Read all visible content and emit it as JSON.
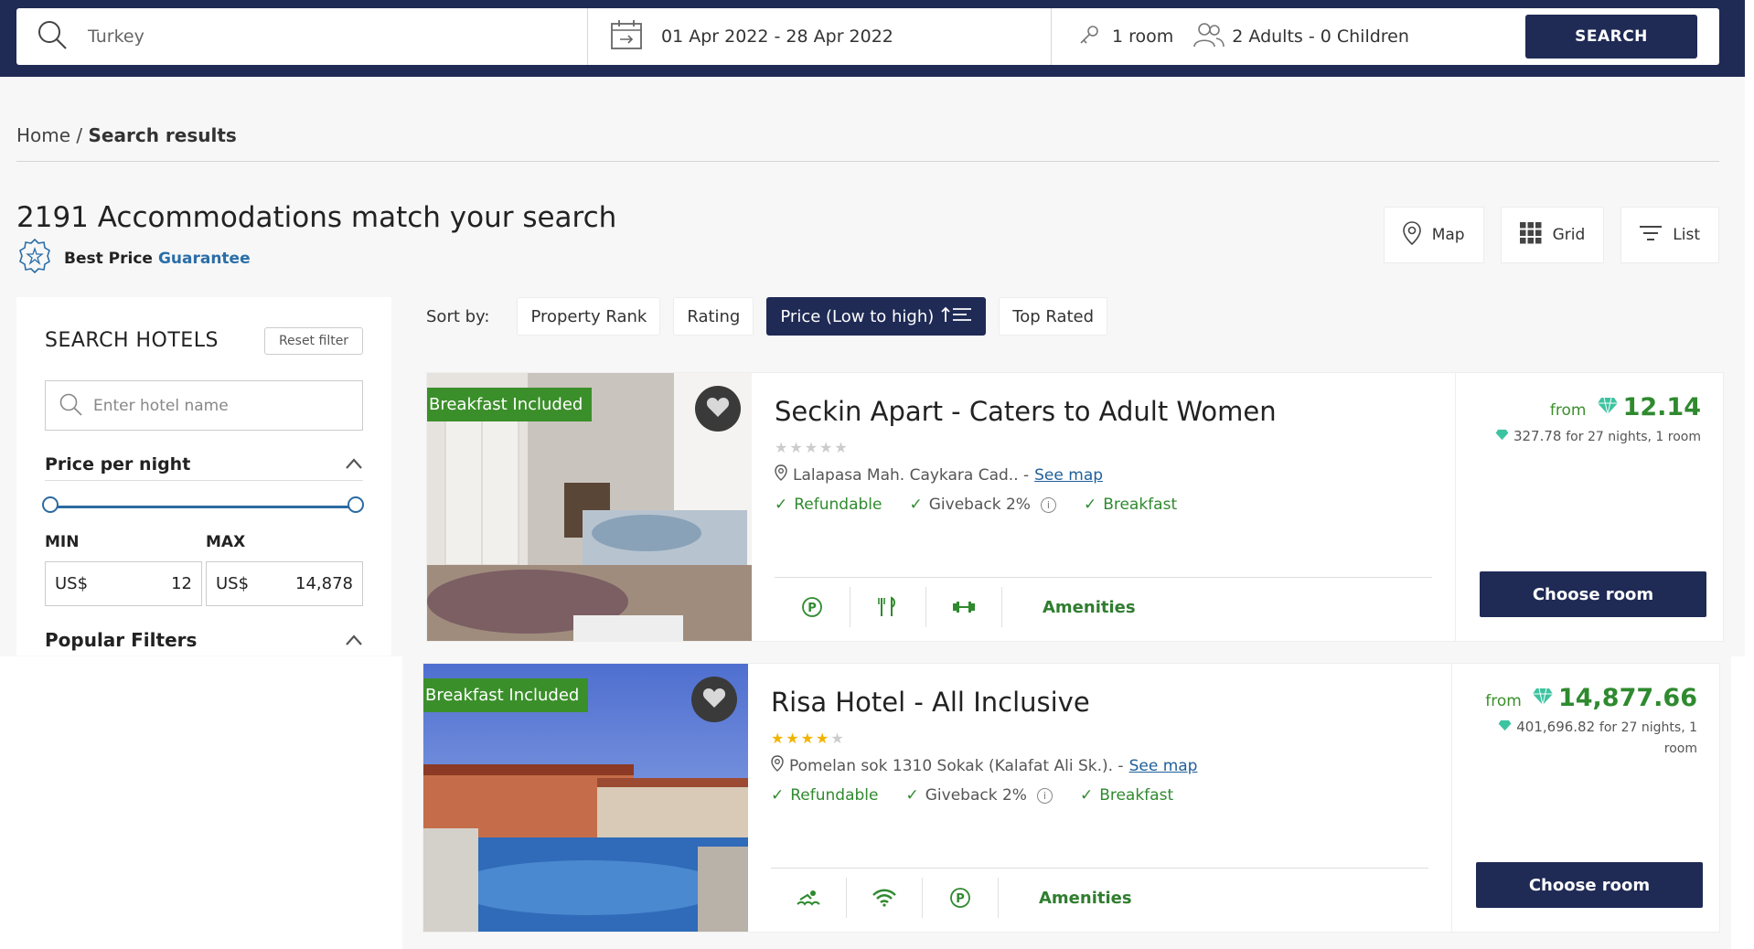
{
  "search": {
    "destination": "Turkey",
    "dates": "01 Apr 2022 - 28 Apr 2022",
    "rooms": "1 room",
    "guests": "2 Adults - 0 Children",
    "button": "SEARCH"
  },
  "breadcrumb": {
    "home": "Home",
    "sep": " / ",
    "current": "Search results"
  },
  "results": {
    "title": "2191 Accommodations match your search",
    "best_price": "Best Price",
    "guarantee": "Guarantee"
  },
  "views": {
    "map": "Map",
    "grid": "Grid",
    "list": "List"
  },
  "sidebar": {
    "title": "SEARCH HOTELS",
    "reset": "Reset filter",
    "hotel_placeholder": "Enter hotel name",
    "price_title": "Price per night",
    "min_label": "MIN",
    "max_label": "MAX",
    "currency": "US$",
    "min_value": "12",
    "max_value": "14,878",
    "popular": "Popular Filters"
  },
  "sort": {
    "label": "Sort by:",
    "options": [
      "Property Rank",
      "Rating",
      "Price (Low to high)",
      "Top Rated"
    ]
  },
  "hotels": [
    {
      "badge": "Breakfast Included",
      "name": "Seckin Apart - Caters to Adult Women",
      "rating": 0,
      "address": "Lalapasa Mah. Caykara Cad.. -",
      "see_map": "See map",
      "features": [
        "Refundable",
        "Giveback 2%",
        "Breakfast"
      ],
      "amenities_label": "Amenities",
      "from": "from",
      "price": "12.14",
      "total_price": "327.78",
      "total_text": "for 27 nights, 1 room",
      "choose": "Choose room"
    },
    {
      "badge": "Breakfast Included",
      "name": "Risa Hotel - All Inclusive",
      "rating": 4,
      "address": "Pomelan sok 1310 Sokak (Kalafat Ali Sk.). -",
      "see_map": "See map",
      "features": [
        "Refundable",
        "Giveback 2%",
        "Breakfast"
      ],
      "amenities_label": "Amenities",
      "from": "from",
      "price": "14,877.66",
      "total_price": "401,696.82",
      "total_text": "for 27 nights, 1 room",
      "choose": "Choose room"
    }
  ],
  "colors": {
    "navy": "#1f2a55",
    "green": "#2f8a2f",
    "link": "#2a6ea8"
  }
}
